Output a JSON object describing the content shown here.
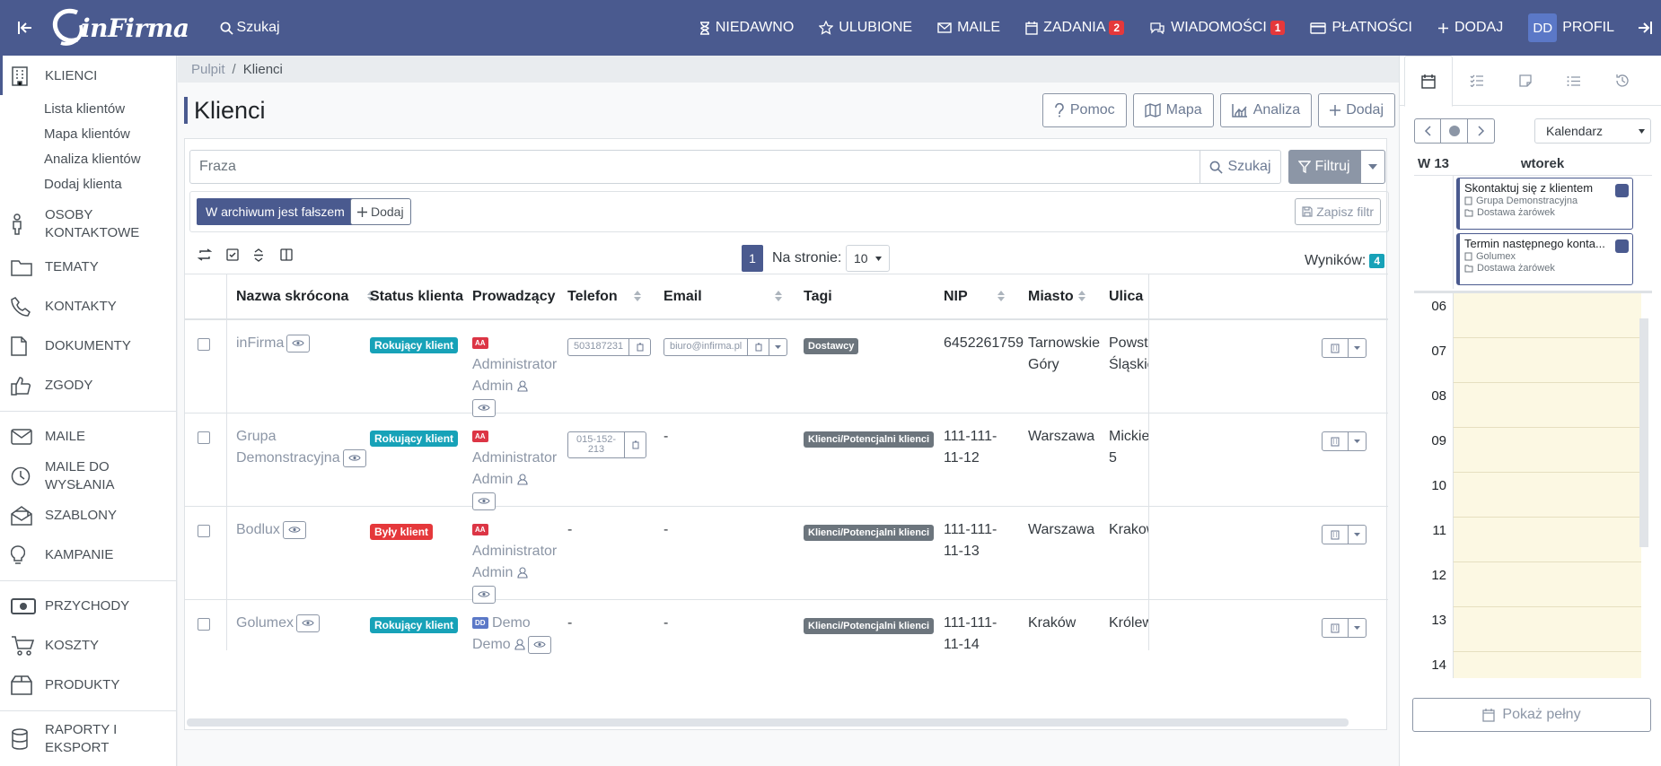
{
  "topbar": {
    "logo": "inFirma",
    "search_label": "Szukaj",
    "nav": [
      {
        "label": "NIEDAWNO",
        "icon": "hourglass-icon"
      },
      {
        "label": "ULUBIONE",
        "icon": "star-icon"
      },
      {
        "label": "MAILE",
        "icon": "envelope-icon"
      },
      {
        "label": "ZADANIA",
        "icon": "calendar-icon",
        "badge": "2"
      },
      {
        "label": "WIADOMOŚCI",
        "icon": "chat-icon",
        "badge": "1"
      },
      {
        "label": "PŁATNOŚCI",
        "icon": "card-icon"
      },
      {
        "label": "DODAJ",
        "icon": "plus-icon"
      }
    ],
    "profile_initials": "DD",
    "profile_label": "PROFIL"
  },
  "sidebar": {
    "items": [
      {
        "label": "KLIENCI",
        "icon": "building-icon"
      },
      {
        "label": "OSOBY KONTAKTOWE",
        "icon": "person-icon"
      },
      {
        "label": "TEMATY",
        "icon": "folder-icon"
      },
      {
        "label": "KONTAKTY",
        "icon": "phone-icon"
      },
      {
        "label": "DOKUMENTY",
        "icon": "file-icon"
      },
      {
        "label": "ZGODY",
        "icon": "thumbs-up-icon"
      },
      {
        "label": "MAILE",
        "icon": "envelope-icon"
      },
      {
        "label": "MAILE DO WYSŁANIA",
        "icon": "clock-icon"
      },
      {
        "label": "SZABLONY",
        "icon": "envelope-open-icon"
      },
      {
        "label": "KAMPANIE",
        "icon": "lightbulb-icon"
      },
      {
        "label": "PRZYCHODY",
        "icon": "cash-icon"
      },
      {
        "label": "KOSZTY",
        "icon": "cart-icon"
      },
      {
        "label": "PRODUKTY",
        "icon": "box-icon"
      },
      {
        "label": "RAPORTY I EKSPORT",
        "icon": "database-icon"
      }
    ],
    "subitems": [
      "Lista klientów",
      "Mapa klientów",
      "Analiza klientów",
      "Dodaj klienta"
    ]
  },
  "breadcrumb": {
    "parent": "Pulpit",
    "sep": "/",
    "current": "Klienci"
  },
  "page": {
    "title": "Klienci",
    "buttons": [
      "Pomoc",
      "Mapa",
      "Analiza",
      "Dodaj"
    ]
  },
  "search": {
    "placeholder": "Fraza",
    "search_label": "Szukaj",
    "filter_label": "Filtruj"
  },
  "filter": {
    "chip": "W archiwum jest fałszem",
    "add_label": "Dodaj",
    "save_label": "Zapisz filtr"
  },
  "pagination": {
    "current_page": "1",
    "per_page_label": "Na stronie:",
    "per_page": "10",
    "results_label": "Wyników:",
    "results_count": "4"
  },
  "table": {
    "headers": [
      "Nazwa skrócona",
      "Status klienta",
      "Prowadzący",
      "Telefon",
      "Email",
      "Tagi",
      "NIP",
      "Miasto",
      "Ulica"
    ],
    "rows": [
      {
        "name": "inFirma",
        "status": "Rokujący klient",
        "status_color": "#17a2b8",
        "owner_badge": "AA",
        "owner": "Administrator Admin",
        "phone": "503187231",
        "email": "biuro@infirma.pl",
        "tag": "Dostawcy",
        "nip1": "6452261759",
        "nip2": "",
        "city1": "Tarnowskie",
        "city2": "Góry",
        "street1": "Powsta",
        "street2": "Śląskich"
      },
      {
        "name": "Grupa",
        "name2": "Demonstracyjna",
        "status": "Rokujący klient",
        "status_color": "#17a2b8",
        "owner_badge": "AA",
        "owner": "Administrator Admin",
        "phone": "015-152-213",
        "email": "-",
        "tag": "Klienci/Potencjalni klienci",
        "nip1": "111-111-",
        "nip2": "11-12",
        "city1": "Warszawa",
        "city2": "",
        "street1": "Mickiew",
        "street2": "5"
      },
      {
        "name": "Bodlux",
        "status": "Były klient",
        "status_color": "#e5383b",
        "owner_badge": "AA",
        "owner": "Administrator Admin",
        "phone": "-",
        "email": "-",
        "tag": "Klienci/Potencjalni klienci",
        "nip1": "111-111-",
        "nip2": "11-13",
        "city1": "Warszawa",
        "city2": "",
        "street1": "Krakow",
        "street2": ""
      },
      {
        "name": "Golumex",
        "status": "Rokujący klient",
        "status_color": "#17a2b8",
        "owner_badge": "DD",
        "owner": "Demo Demo",
        "phone": "-",
        "email": "-",
        "tag": "Klienci/Potencjalni klienci",
        "nip1": "111-111-",
        "nip2": "11-14",
        "city1": "Kraków",
        "city2": "",
        "street1": "Królews",
        "street2": ""
      }
    ]
  },
  "calendar": {
    "view_select": "Kalendarz",
    "week": "W 13",
    "day": "wtorek",
    "events": [
      {
        "title": "Skontaktuj się z klientem",
        "client": "Grupa Demonstracyjna",
        "topic": "Dostawa żarówek"
      },
      {
        "title": "Termin następnego konta...",
        "client": "Golumex",
        "topic": "Dostawa żarówek"
      }
    ],
    "hours": [
      "06",
      "07",
      "08",
      "09",
      "10",
      "11",
      "12",
      "13",
      "14"
    ],
    "show_full": "Pokaż pełny"
  }
}
